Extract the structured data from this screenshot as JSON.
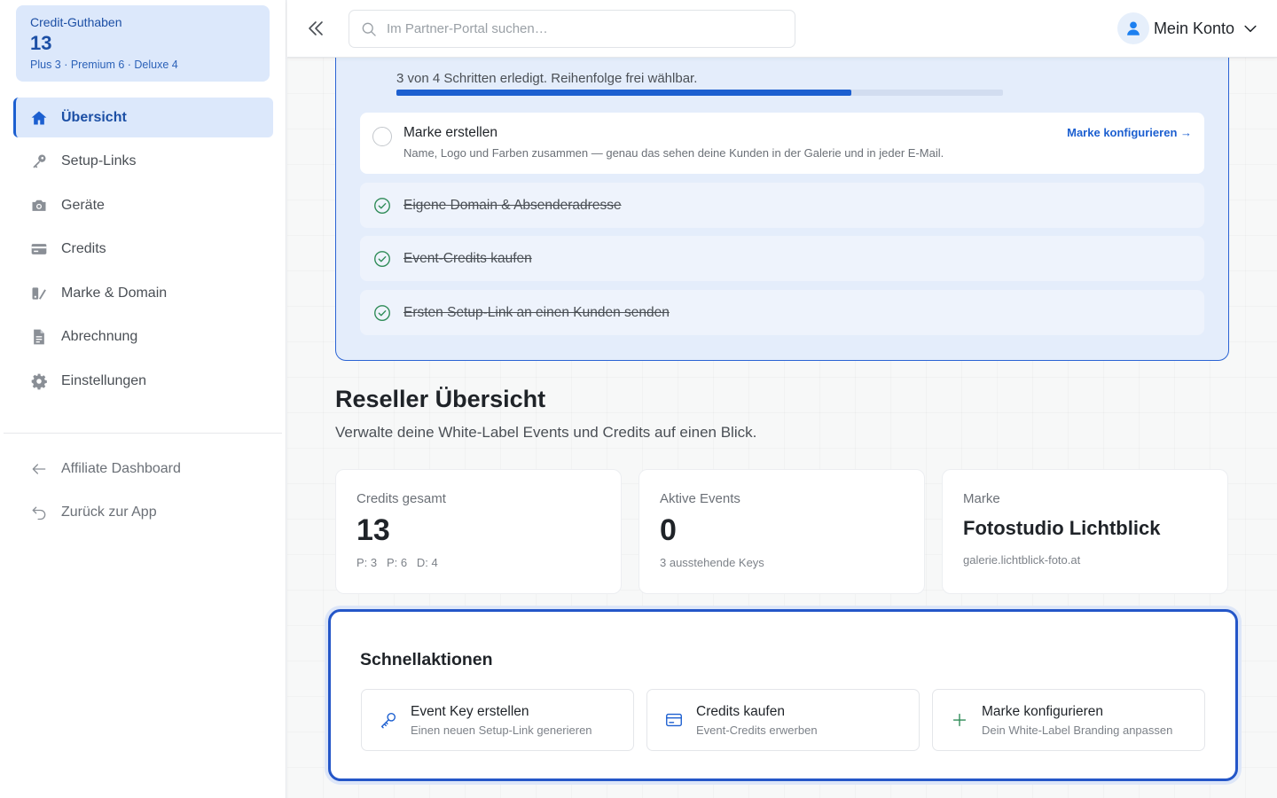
{
  "sidebar": {
    "credit": {
      "title": "Credit-Guthaben",
      "value": "13",
      "breakdown": "Plus 3 · Premium 6 · Deluxe 4"
    },
    "items": [
      {
        "label": "Übersicht",
        "icon": "home-icon",
        "active": true
      },
      {
        "label": "Setup-Links",
        "icon": "key-icon"
      },
      {
        "label": "Geräte",
        "icon": "camera-icon"
      },
      {
        "label": "Credits",
        "icon": "credit-card-icon"
      },
      {
        "label": "Marke & Domain",
        "icon": "brand-icon"
      },
      {
        "label": "Abrechnung",
        "icon": "document-icon"
      },
      {
        "label": "Einstellungen",
        "icon": "gear-icon"
      }
    ],
    "secondary": [
      {
        "label": "Affiliate Dashboard",
        "icon": "arrow-left-icon"
      },
      {
        "label": "Zurück zur App",
        "icon": "undo-icon"
      }
    ]
  },
  "topbar": {
    "search_placeholder": "Im Partner-Portal suchen…",
    "account_label": "Mein Konto"
  },
  "setup": {
    "progress_text": "3 von 4 Schritten erledigt. Reihenfolge frei wählbar.",
    "progress_value": 0.75,
    "steps": [
      {
        "title": "Marke erstellen",
        "desc": "Name, Logo und Farben zusammen — genau das sehen deine Kunden in der Galerie und in jeder E-Mail.",
        "link": "Marke konfigurieren →",
        "done": false
      },
      {
        "title": "Eigene Domain & Absenderadresse",
        "done": true
      },
      {
        "title": "Event-Credits kaufen",
        "done": true
      },
      {
        "title": "Ersten Setup-Link an einen Kunden senden",
        "done": true
      }
    ]
  },
  "overview": {
    "title": "Reseller Übersicht",
    "subtitle": "Verwalte deine White-Label Events und Credits auf einen Blick."
  },
  "stats": [
    {
      "label": "Credits gesamt",
      "value": "13",
      "sub": "P: 3   P: 6   D: 4"
    },
    {
      "label": "Aktive Events",
      "value": "0",
      "sub": "3 ausstehende Keys"
    },
    {
      "label": "Marke",
      "value": "Fotostudio Lichtblick",
      "sub": "galerie.lichtblick-foto.at"
    }
  ],
  "quick": {
    "title": "Schnellaktionen",
    "actions": [
      {
        "title": "Event Key erstellen",
        "sub": "Einen neuen Setup-Link generieren",
        "icon": "key-icon"
      },
      {
        "title": "Credits kaufen",
        "sub": "Event-Credits erwerben",
        "icon": "credit-card-icon"
      },
      {
        "title": "Marke konfigurieren",
        "sub": "Dein White-Label Branding anpassen",
        "icon": "plus-icon"
      }
    ]
  },
  "colors": {
    "accent": "#1c5fd0",
    "accent_light": "#dce8fb",
    "success": "#2e8b57"
  }
}
